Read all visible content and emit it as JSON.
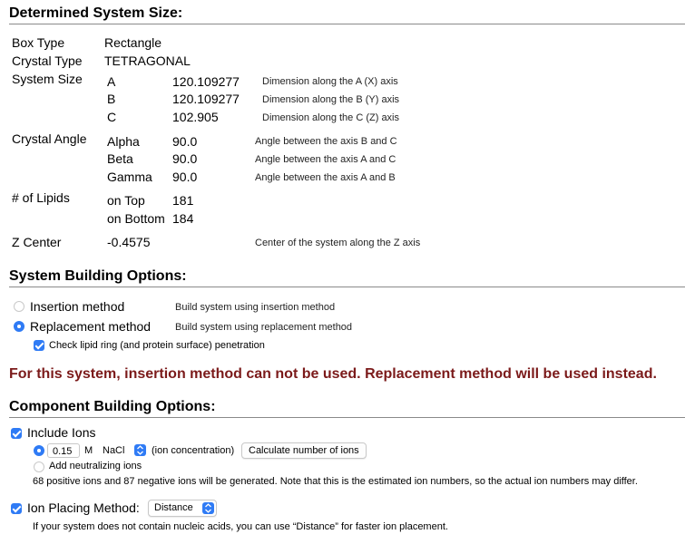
{
  "determined": {
    "title": "Determined System Size:",
    "box_type_label": "Box Type",
    "box_type_value": "Rectangle",
    "crystal_type_label": "Crystal Type",
    "crystal_type_value": "TETRAGONAL",
    "system_size_label": "System Size",
    "size_rows": [
      {
        "axis": "A",
        "value": "120.109277",
        "desc": "Dimension along the A (X) axis"
      },
      {
        "axis": "B",
        "value": "120.109277",
        "desc": "Dimension along the B (Y) axis"
      },
      {
        "axis": "C",
        "value": "102.905",
        "desc": "Dimension along the C (Z) axis"
      }
    ],
    "crystal_angle_label": "Crystal Angle",
    "angle_rows": [
      {
        "name": "Alpha",
        "value": "90.0",
        "desc": "Angle between the axis B and C"
      },
      {
        "name": "Beta",
        "value": "90.0",
        "desc": "Angle between the axis A and C"
      },
      {
        "name": "Gamma",
        "value": "90.0",
        "desc": "Angle between the axis A and B"
      }
    ],
    "lipids_label": "# of Lipids",
    "lipid_rows": [
      {
        "name": "on Top",
        "value": "181"
      },
      {
        "name": "on Bottom",
        "value": "184"
      }
    ],
    "zcenter_label": "Z Center",
    "zcenter_value": "-0.4575",
    "zcenter_desc": "Center of the system along the Z axis"
  },
  "building": {
    "title": "System Building Options:",
    "insertion_label": "Insertion method",
    "insertion_desc": "Build system using insertion method",
    "replacement_label": "Replacement method",
    "replacement_desc": "Build system using replacement method",
    "penetration_label": "Check lipid ring (and protein surface) penetration"
  },
  "warning": "For this system, insertion method can not be used. Replacement method will be used instead.",
  "component": {
    "title": "Component Building Options:",
    "include_ions_label": "Include Ions",
    "concentration_value": "0.15",
    "unit": "M",
    "ion_type": "NaCl",
    "ion_concentration_label": "(ion concentration)",
    "calculate_button": "Calculate number of ions",
    "neutralizing_label": "Add neutralizing ions",
    "ion_note": "68 positive ions and 87 negative ions will be generated. Note that this is the estimated ion numbers, so the actual ion numbers may differ.",
    "placing_label": "Ion Placing Method:",
    "placing_value": "Distance",
    "placing_note": "If your system does not contain nucleic acids, you can use “Distance” for faster ion placement."
  },
  "colors": {
    "accent": "#2f7bf5",
    "warning": "#7b1a1a"
  }
}
